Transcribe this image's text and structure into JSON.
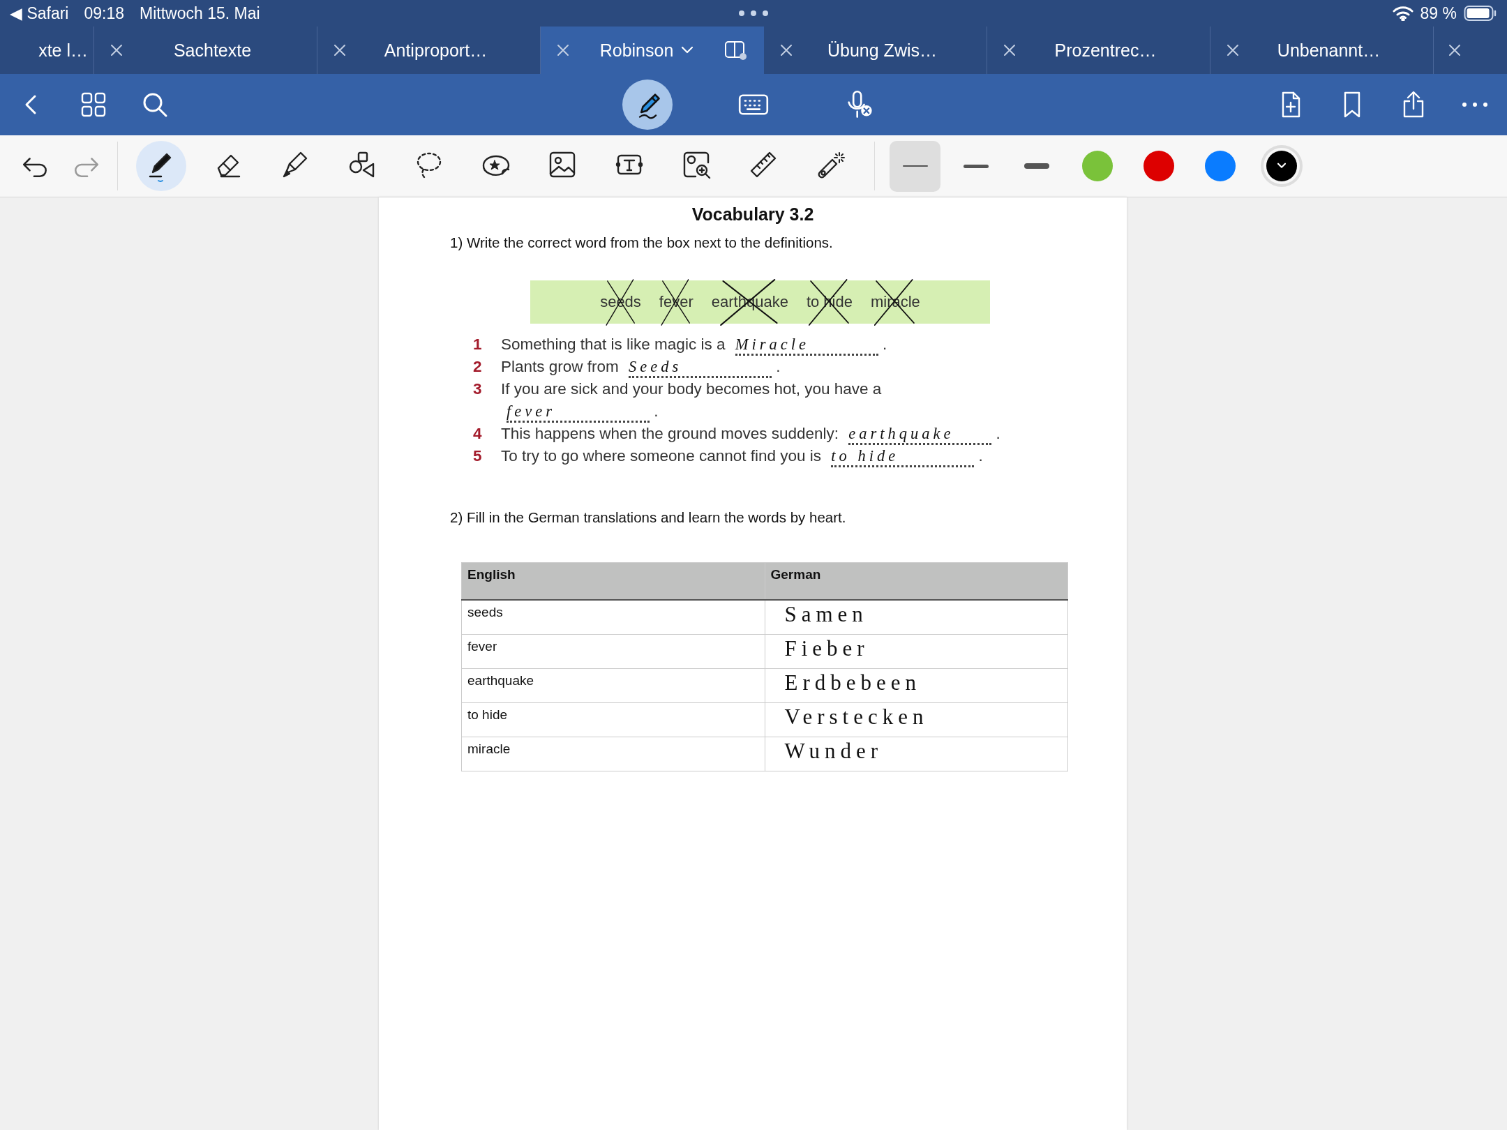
{
  "status_bar": {
    "back_app": "◀ Safari",
    "time": "09:18",
    "date": "Mittwoch 15. Mai",
    "battery": "89 %"
  },
  "tabs": [
    {
      "title": "xte l…",
      "selected": false
    },
    {
      "title": "Sachtexte",
      "selected": false
    },
    {
      "title": "Antiproport…",
      "selected": false
    },
    {
      "title": "Robinson",
      "selected": true
    },
    {
      "title": "Übung Zwis…",
      "selected": false
    },
    {
      "title": "Prozentrec…",
      "selected": false
    },
    {
      "title": "Unbenannt…",
      "selected": false
    }
  ],
  "modes": [
    {
      "kind": "pen",
      "selected": true
    },
    {
      "kind": "keyboard",
      "selected": false
    },
    {
      "kind": "dictation",
      "selected": false
    }
  ],
  "tools": [
    {
      "kind": "pen",
      "selected": true
    },
    {
      "kind": "eraser",
      "selected": false
    },
    {
      "kind": "highlighter",
      "selected": false
    },
    {
      "kind": "shapes",
      "selected": false
    },
    {
      "kind": "lasso",
      "selected": false
    },
    {
      "kind": "sticker",
      "selected": false
    },
    {
      "kind": "image",
      "selected": false
    },
    {
      "kind": "text",
      "selected": false
    },
    {
      "kind": "zoom",
      "selected": false
    },
    {
      "kind": "ruler",
      "selected": false
    },
    {
      "kind": "laser",
      "selected": false
    }
  ],
  "stroke_widths": [
    {
      "kind": "thin",
      "selected": true
    },
    {
      "kind": "medium",
      "selected": false
    },
    {
      "kind": "thick",
      "selected": false
    }
  ],
  "pen_colors": [
    {
      "color": "#7ac23a",
      "selected": false
    },
    {
      "color": "#dd0000",
      "selected": false
    },
    {
      "color": "#0a7cff",
      "selected": false
    },
    {
      "color": "#000000",
      "selected": true
    }
  ],
  "page": {
    "title": "Vocabulary 3.2",
    "task_1": "1) Write the correct word from the box next to the definitions.",
    "word_box": [
      {
        "word": "seeds",
        "crossed": true
      },
      {
        "word": "fever",
        "crossed": true
      },
      {
        "word": "earthquake",
        "crossed": true
      },
      {
        "word": "to hide",
        "crossed": true
      },
      {
        "word": "miracle",
        "crossed": true
      }
    ],
    "items": [
      {
        "number": "1",
        "text": "Something that is like magic is a",
        "answer": "Miracle",
        "end": "."
      },
      {
        "number": "2",
        "text": "Plants grow from",
        "answer": "Seeds",
        "end": "."
      },
      {
        "number": "3",
        "text": "If you are sick and your body becomes hot, you have a",
        "answer": "fever",
        "end": "."
      },
      {
        "number": "4",
        "text": "This happens when the ground moves suddenly:",
        "answer": "earthquake",
        "end": "."
      },
      {
        "number": "5",
        "text": "To try to go where someone cannot find you is",
        "answer": "to hide",
        "end": "."
      }
    ],
    "task_2": "2) Fill in the German translations and learn the words by heart.",
    "table": {
      "columns": [
        "English",
        "German"
      ],
      "rows": [
        {
          "english": "seeds",
          "german": "Samen"
        },
        {
          "english": "fever",
          "german": "Fieber"
        },
        {
          "english": "earthquake",
          "german": "Erdbebeen"
        },
        {
          "english": "to hide",
          "german": "Verstecken"
        },
        {
          "english": "miracle",
          "german": "Wunder"
        }
      ]
    }
  }
}
